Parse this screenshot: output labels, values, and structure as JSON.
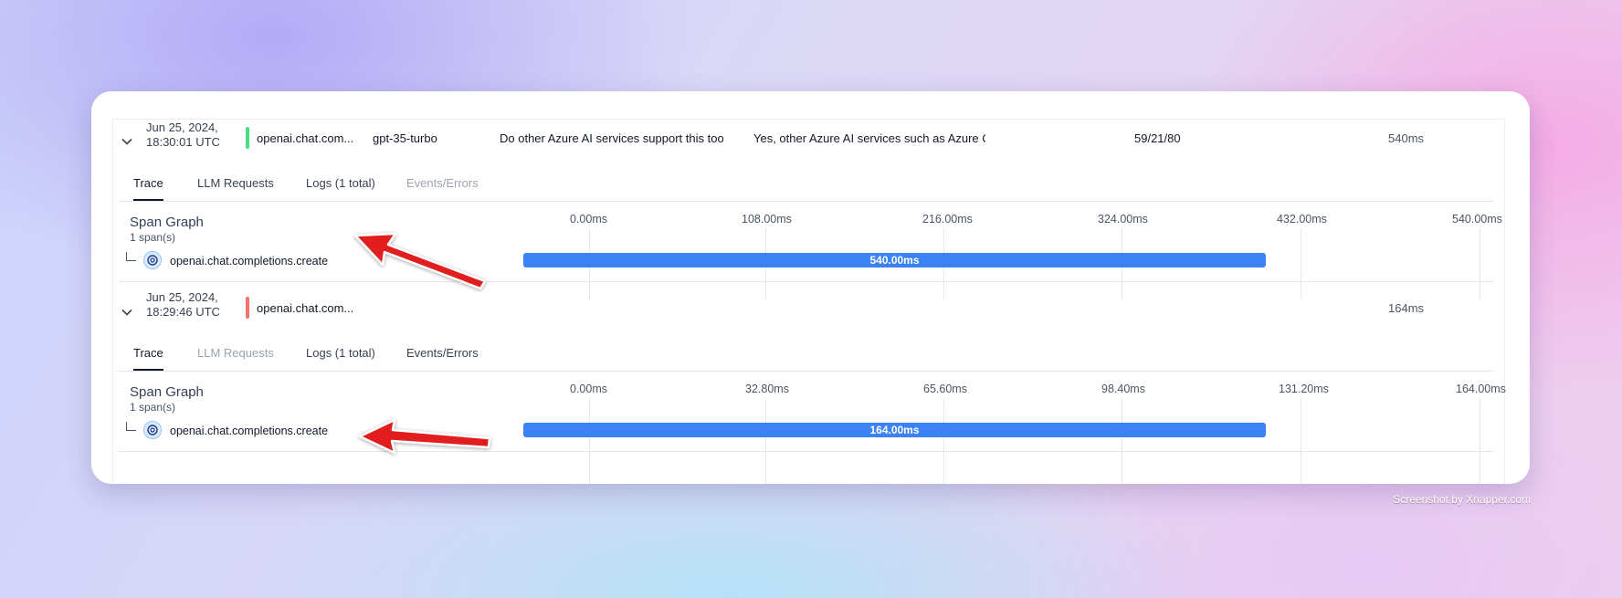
{
  "rows": [
    {
      "date_line1": "Jun 25, 2024,",
      "date_line2": "18:30:01 UTC",
      "status_color": "#4ade80",
      "name": "openai.chat.com...",
      "model": "gpt-35-turbo",
      "input": "Do other Azure AI services support this too?",
      "output": "Yes, other Azure AI services such as Azure Cognitive",
      "tokens": "59/21/80",
      "latency": "540ms",
      "tabs": [
        {
          "label": "Trace",
          "state": "active"
        },
        {
          "label": "LLM Requests",
          "state": "normal"
        },
        {
          "label": "Logs (1 total)",
          "state": "normal"
        },
        {
          "label": "Events/Errors",
          "state": "disabled"
        }
      ],
      "span_graph_title": "Span Graph",
      "span_count": "1 span(s)",
      "ticks": [
        "0.00ms",
        "108.00ms",
        "216.00ms",
        "324.00ms",
        "432.00ms",
        "540.00ms"
      ],
      "span_name": "openai.chat.completions.create",
      "span_duration": "540.00ms",
      "span_fraction": 1.0
    },
    {
      "date_line1": "Jun 25, 2024,",
      "date_line2": "18:29:46 UTC",
      "status_color": "#f87171",
      "name": "openai.chat.com...",
      "model": "",
      "input": "",
      "output": "",
      "tokens": "",
      "latency": "164ms",
      "tabs": [
        {
          "label": "Trace",
          "state": "active"
        },
        {
          "label": "LLM Requests",
          "state": "disabled"
        },
        {
          "label": "Logs (1 total)",
          "state": "normal"
        },
        {
          "label": "Events/Errors",
          "state": "normal"
        }
      ],
      "span_graph_title": "Span Graph",
      "span_count": "1 span(s)",
      "ticks": [
        "0.00ms",
        "32.80ms",
        "65.60ms",
        "98.40ms",
        "131.20ms",
        "164.00ms"
      ],
      "span_name": "openai.chat.completions.create",
      "span_duration": "164.00ms",
      "span_fraction": 1.0
    }
  ],
  "icons": {
    "expand": "chevron-down-icon",
    "span": "openai-logo-icon",
    "annotation": "red-arrow-annotation"
  },
  "colors": {
    "bar": "#3b82f6",
    "arrow": "#e11d1d"
  },
  "watermark": "Screenshot by Xnapper.com"
}
